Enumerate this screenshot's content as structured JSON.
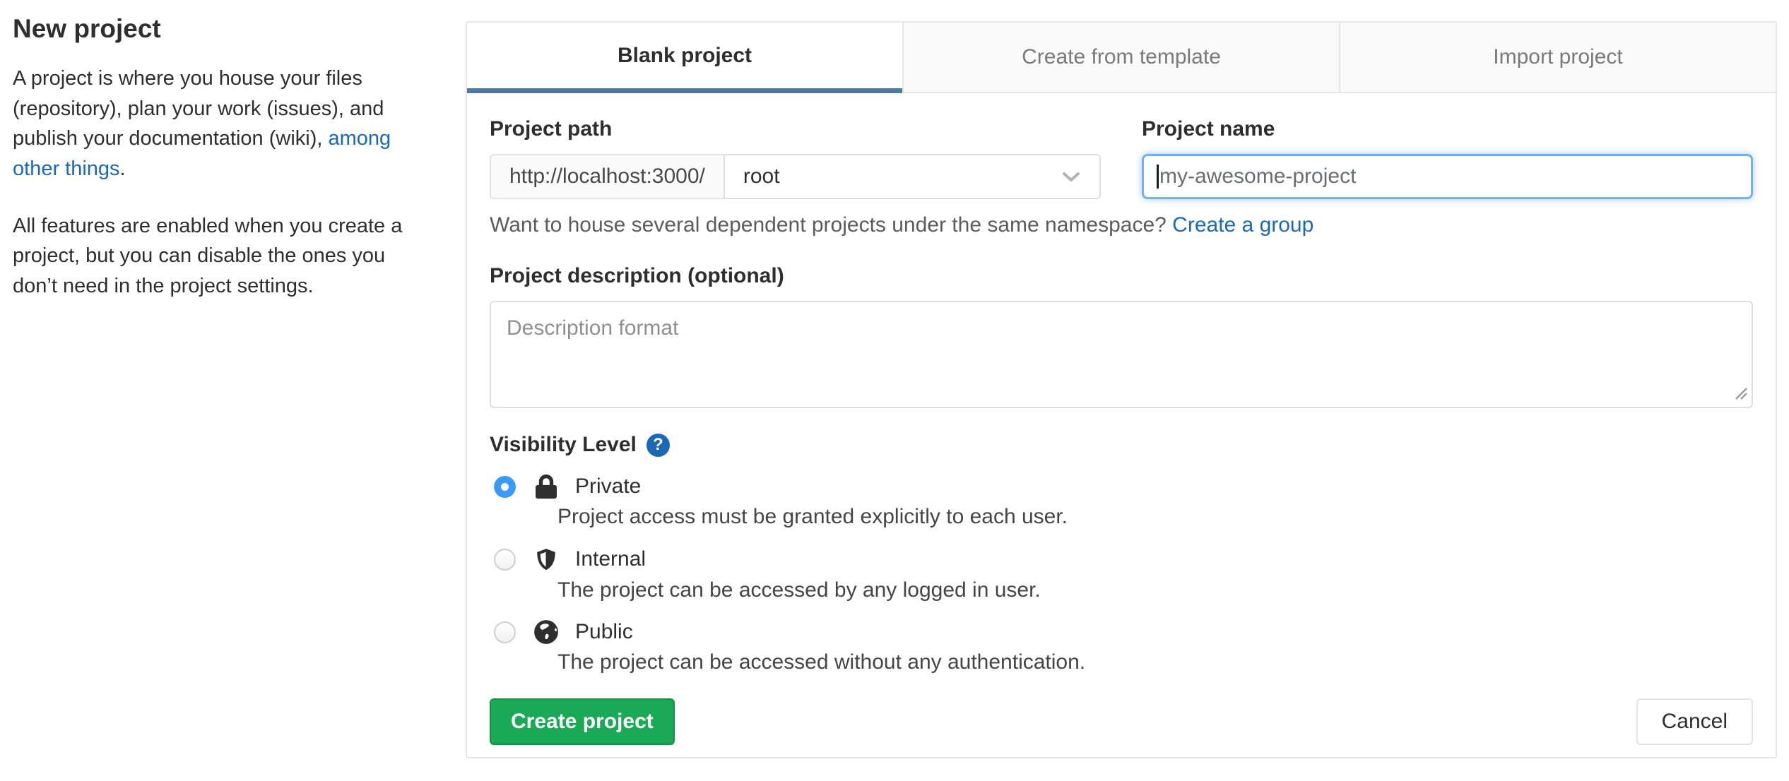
{
  "sidebar": {
    "title": "New project",
    "intro_text": "A project is where you house your files (repository), plan your work (issues), and publish your documentation (wiki), ",
    "intro_link": "among other things",
    "intro_suffix": ".",
    "features_text": "All features are enabled when you create a project, but you can disable the ones you don’t need in the project settings."
  },
  "tabs": [
    {
      "label": "Blank project",
      "active": true
    },
    {
      "label": "Create from template",
      "active": false
    },
    {
      "label": "Import project",
      "active": false
    }
  ],
  "form": {
    "project_path": {
      "label": "Project path",
      "url_prefix": "http://localhost:3000/",
      "namespace_selected": "root"
    },
    "project_name": {
      "label": "Project name",
      "placeholder": "my-awesome-project",
      "value": ""
    },
    "namespace_hint": {
      "text": "Want to house several dependent projects under the same namespace?",
      "link": "Create a group"
    },
    "description": {
      "label": "Project description (optional)",
      "placeholder": "Description format",
      "value": ""
    },
    "visibility": {
      "label": "Visibility Level",
      "help_icon": "question-circle-icon",
      "help_glyph": "?",
      "options": [
        {
          "name": "Private",
          "icon": "lock-icon",
          "selected": true,
          "description": "Project access must be granted explicitly to each user."
        },
        {
          "name": "Internal",
          "icon": "shield-icon",
          "selected": false,
          "description": "The project can be accessed by any logged in user."
        },
        {
          "name": "Public",
          "icon": "globe-icon",
          "selected": false,
          "description": "The project can be accessed without any authentication."
        }
      ]
    },
    "actions": {
      "create_label": "Create project",
      "cancel_label": "Cancel"
    }
  },
  "colors": {
    "link_blue": "#1b69b6",
    "active_tab_underline": "#4a79a8",
    "selected_radio_blue": "#3b99fc",
    "focus_border_blue": "#76b0e8",
    "create_button_green": "#1aaa55",
    "create_button_border": "#168f48",
    "panel_border": "#e6e6e6",
    "inactive_tab_bg": "#fafafa"
  }
}
